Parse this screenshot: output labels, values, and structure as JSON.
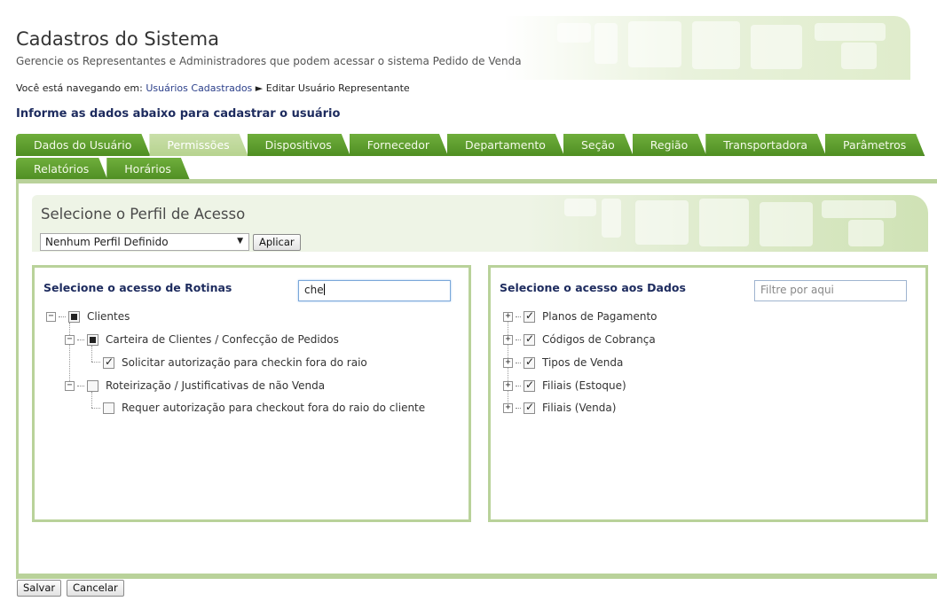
{
  "header": {
    "title": "Cadastros do Sistema",
    "subtitle": "Gerencie os Representantes e Administradores que podem acessar o sistema Pedido de Venda"
  },
  "breadcrumb": {
    "prefix": "Você está navegando em:",
    "link": "Usuários Cadastrados",
    "separator": "►",
    "current": "Editar Usuário Representante"
  },
  "form_heading": "Informe as dados abaixo para cadastrar o usuário",
  "tabs_row1": [
    "Dados do Usuário",
    "Permissões",
    "Dispositivos",
    "Fornecedor",
    "Departamento",
    "Seção",
    "Região",
    "Transportadora",
    "Parâmetros"
  ],
  "tabs_row2": [
    "Relatórios",
    "Horários"
  ],
  "active_tab": "Permissões",
  "profile": {
    "title": "Selecione o Perfil de Acesso",
    "selected": "Nenhum Perfil Definido",
    "apply_label": "Aplicar"
  },
  "routines_panel": {
    "title": "Selecione o acesso de Rotinas",
    "filter_value": "che",
    "tree": [
      {
        "label": "Clientes",
        "state": "partial",
        "expander": "−"
      },
      {
        "label": "Carteira de Clientes / Confecção de Pedidos",
        "state": "partial",
        "expander": "−"
      },
      {
        "label": "Solicitar autorização para checkin fora do raio",
        "state": "checked"
      },
      {
        "label": "Roteirização / Justificativas de não Venda",
        "state": "unchecked",
        "expander": "−"
      },
      {
        "label": "Requer autorização para checkout fora do raio do cliente",
        "state": "unchecked"
      }
    ]
  },
  "data_panel": {
    "title": "Selecione o acesso aos Dados",
    "filter_placeholder": "Filtre por aqui",
    "items": [
      {
        "label": "Planos de Pagamento",
        "state": "checked",
        "expander": "+"
      },
      {
        "label": "Códigos de Cobrança",
        "state": "checked",
        "expander": "+"
      },
      {
        "label": "Tipos de Venda",
        "state": "checked",
        "expander": "+"
      },
      {
        "label": "Filiais (Estoque)",
        "state": "checked",
        "expander": "+"
      },
      {
        "label": "Filiais (Venda)",
        "state": "checked",
        "expander": "+"
      }
    ]
  },
  "buttons": {
    "save_label": "Salvar",
    "cancel_label": "Cancelar"
  },
  "colors": {
    "tab_green": "#5b9a2c",
    "tab_active": "#c2da9f",
    "frame_border": "#b9d29a",
    "heading_navy": "#1d2b5e"
  }
}
